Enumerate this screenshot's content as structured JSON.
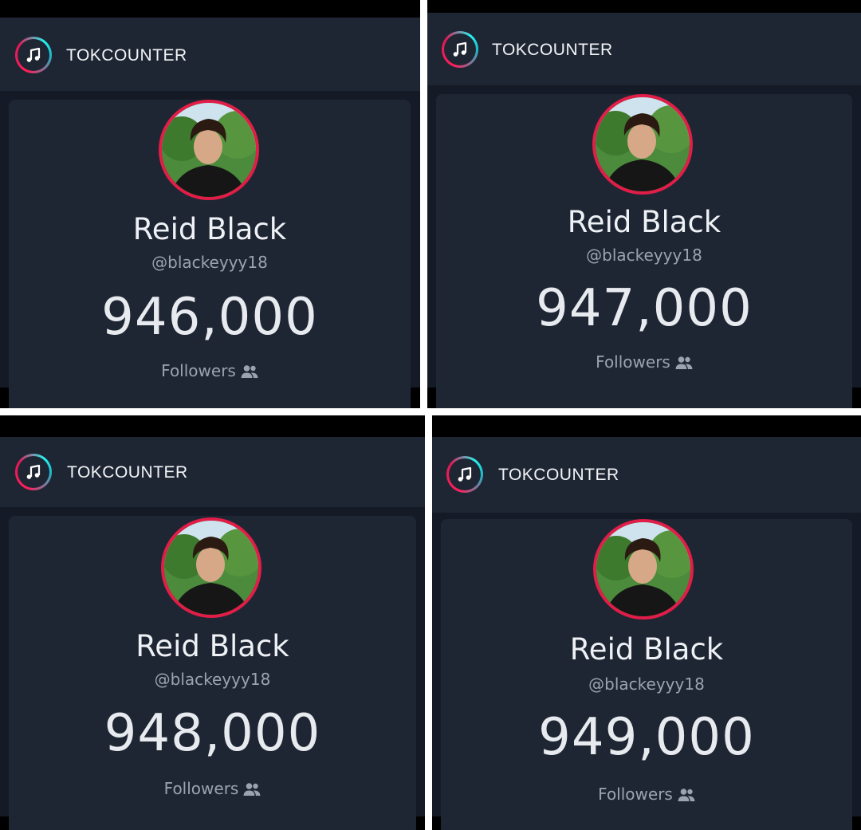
{
  "panels": [
    {
      "brand": "TOKCOUNTER",
      "display_name": "Reid Black",
      "handle": "@blackeyyy18",
      "follower_count": "946,000",
      "followers_label": "Followers",
      "icons": [
        "music-note-icon",
        "users-icon"
      ]
    },
    {
      "brand": "TOKCOUNTER",
      "display_name": "Reid Black",
      "handle": "@blackeyyy18",
      "follower_count": "947,000",
      "followers_label": "Followers",
      "icons": [
        "music-note-icon",
        "users-icon"
      ]
    },
    {
      "brand": "TOKCOUNTER",
      "display_name": "Reid Black",
      "handle": "@blackeyyy18",
      "follower_count": "948,000",
      "followers_label": "Followers",
      "icons": [
        "music-note-icon",
        "users-icon"
      ]
    },
    {
      "brand": "TOKCOUNTER",
      "display_name": "Reid Black",
      "handle": "@blackeyyy18",
      "follower_count": "949,000",
      "followers_label": "Followers",
      "icons": [
        "music-note-icon",
        "users-icon"
      ]
    }
  ],
  "colors": {
    "app_background": "#151b26",
    "header_background": "#1f2633",
    "card_background": "#1f2633",
    "avatar_ring": "#e11d48",
    "brand_pink": "#ff1f5b",
    "brand_cyan": "#25f4ee",
    "count_text": "#e7eaef",
    "muted_text": "#9aa3b2"
  }
}
